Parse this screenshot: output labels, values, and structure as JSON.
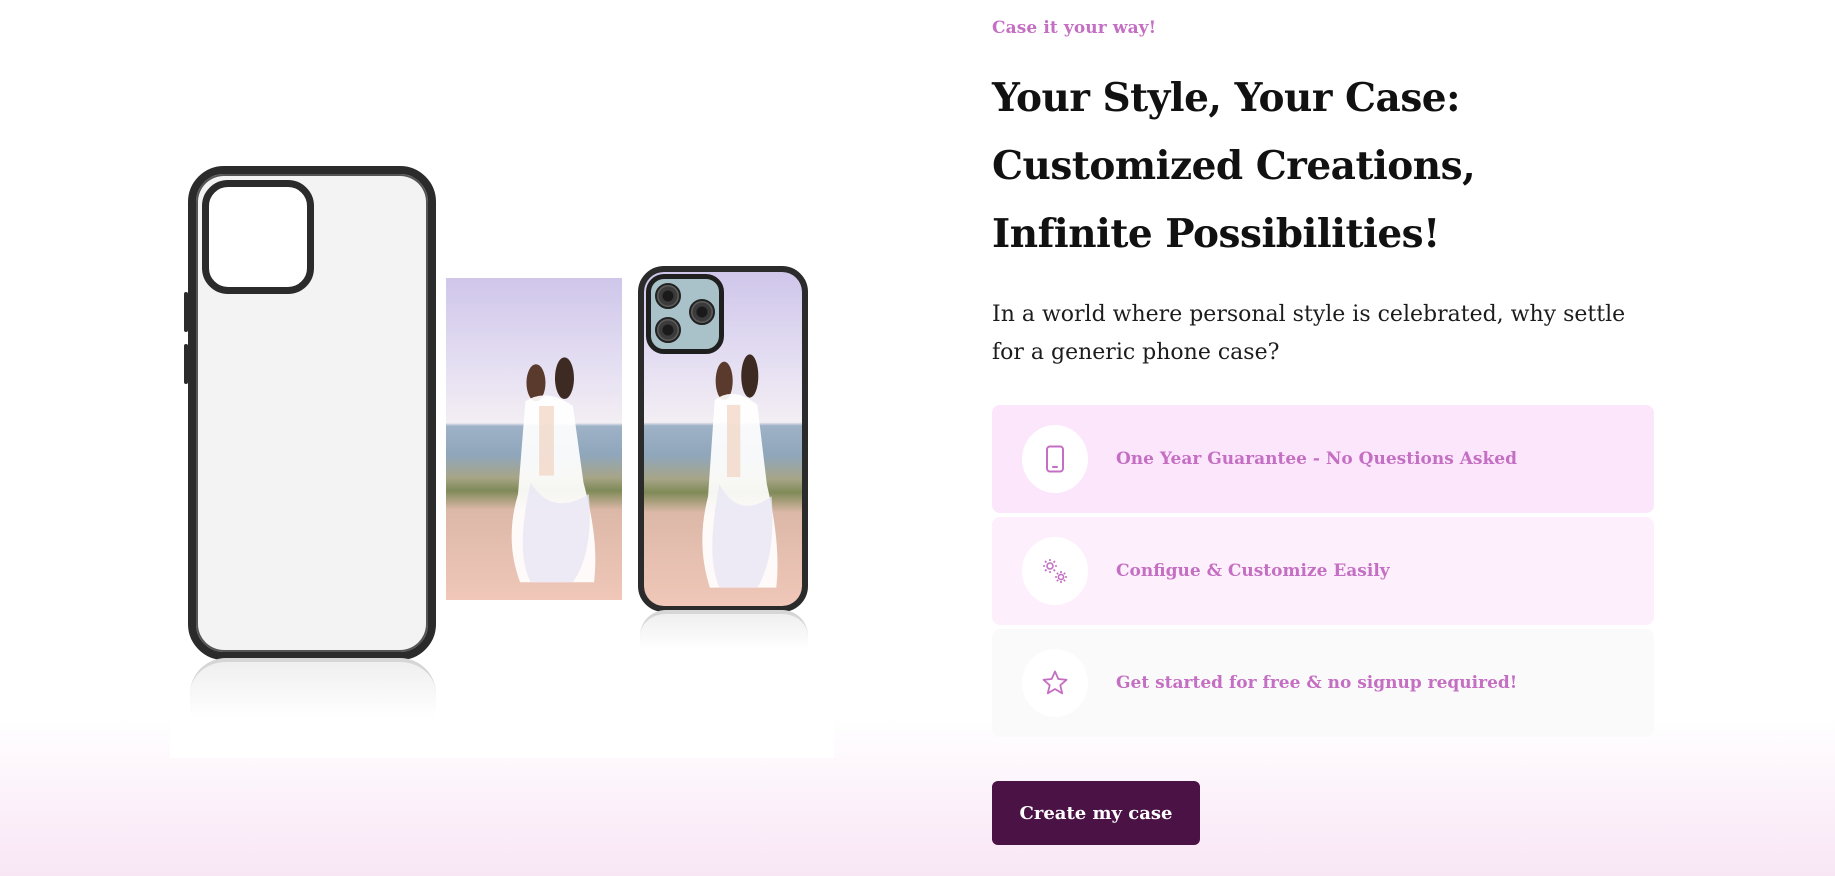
{
  "hero": {
    "eyebrow": "Case it your way!",
    "headline": "Your Style, Your Case: Customized Creations, Infinite Possibilities!",
    "intro": "In a world where personal style is celebrated, why settle for a generic phone case?",
    "features": [
      {
        "icon": "phone-icon",
        "label": "One Year Guarantee - No Questions Asked"
      },
      {
        "icon": "gears-icon",
        "label": "Configue & Customize Easily"
      },
      {
        "icon": "star-icon",
        "label": "Get started for free & no signup required!"
      }
    ],
    "cta_label": "Create my case"
  },
  "colors": {
    "accent": "#c46fc3",
    "cta_background": "#4a1245",
    "feature_backgrounds": [
      "#fce6fc",
      "#fdf0fc",
      "#fafafa"
    ]
  }
}
